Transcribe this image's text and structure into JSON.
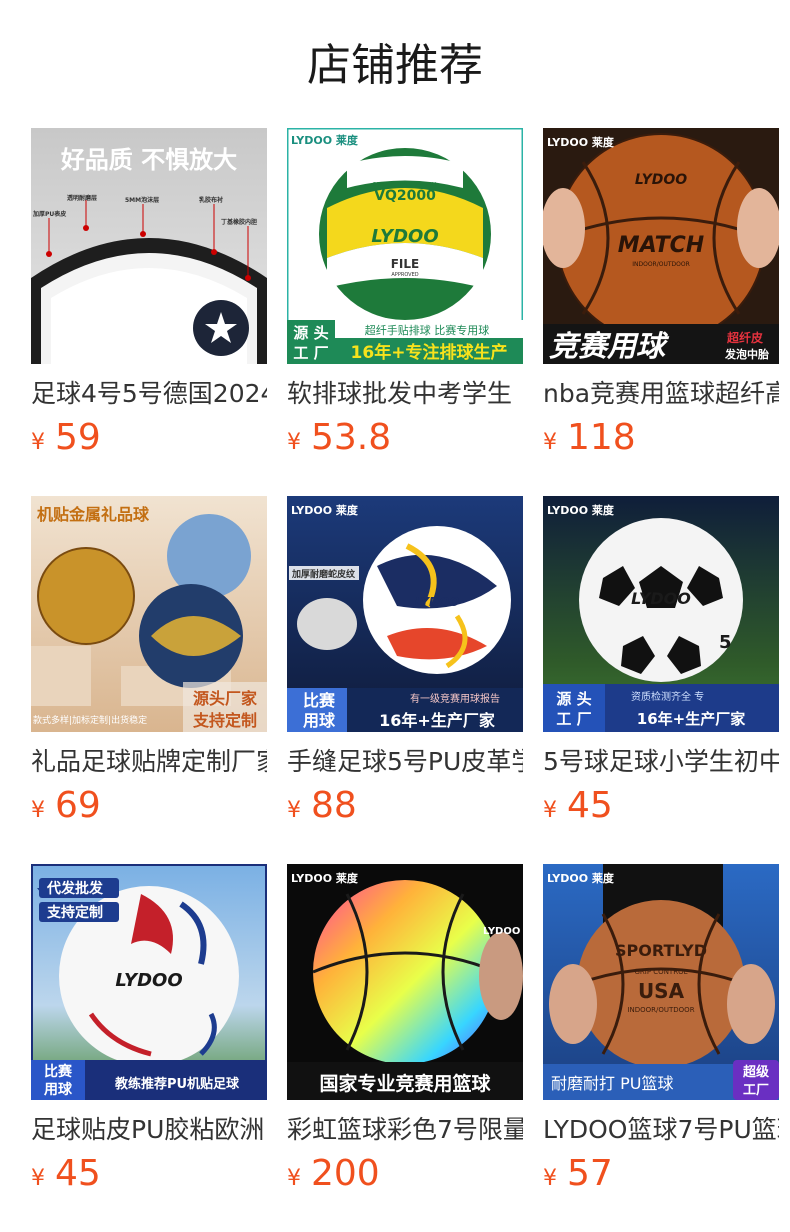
{
  "page": {
    "title": "店铺推荐"
  },
  "colors": {
    "price": "#f0501e",
    "title": "#1a1a1a",
    "text": "#333333"
  },
  "products": [
    {
      "name": "足球4号5号德国2024",
      "currency": "¥",
      "price": "59",
      "image_text": [
        "好品质 不惧放大",
        "透明耐磨层",
        "5MM泡沫层",
        "加厚PU表皮",
        "乳胶布衬",
        "丁基橡胶内胆"
      ]
    },
    {
      "name": "软排球批发中考学生",
      "currency": "¥",
      "price": "53.8",
      "image_text": [
        "LYDOO 莱度",
        "COMPETITION GAME BALL",
        "VQ2000",
        "LYDOO",
        "FILE",
        "APPROVED",
        "超纤手贴排球 比赛专用球",
        "源 头",
        "工 厂",
        "16年+专注排球生产"
      ]
    },
    {
      "name": "nba竞赛用篮球超纤高",
      "currency": "¥",
      "price": "118",
      "image_text": [
        "LYDOO 莱度",
        "LYDOO",
        "MATCH",
        "INDOOR/OUTDOOR",
        "竞赛用球",
        "超纤皮",
        "发泡中胎"
      ]
    },
    {
      "name": "礼品足球贴牌定制厂家",
      "currency": "¥",
      "price": "69",
      "image_text": [
        "机贴金属礼品球",
        "款式多样|加标定制|出货稳定",
        "源头厂家",
        "支持定制"
      ]
    },
    {
      "name": "手缝足球5号PU皮革学",
      "currency": "¥",
      "price": "88",
      "image_text": [
        "LYDOO 莱度",
        "加厚耐磨蛇皮纹",
        "LYDOO",
        "比赛",
        "用球",
        "有一级竞赛用球报告",
        "16年+生产厂家"
      ]
    },
    {
      "name": "5号球足球小学生初中",
      "currency": "¥",
      "price": "45",
      "image_text": [
        "LYDOO 莱度",
        "LYDOO",
        "5",
        "源 头",
        "工 厂",
        "资质检测齐全 专",
        "16年+生产厂家"
      ]
    },
    {
      "name": "足球贴皮PU胶粘欧洲",
      "currency": "¥",
      "price": "45",
      "image_text": [
        "代发批发",
        "支持定制",
        "LYDOO",
        "比赛",
        "用球",
        "教练推荐PU机贴足球"
      ]
    },
    {
      "name": "彩虹篮球彩色7号限量",
      "currency": "¥",
      "price": "200",
      "image_text": [
        "LYDOO 莱度",
        "LYDOO",
        "国家专业竞赛用篮球"
      ]
    },
    {
      "name": "LYDOO篮球7号PU篮球",
      "currency": "¥",
      "price": "57",
      "image_text": [
        "LYDOO 莱度",
        "SPORTLYD",
        "GRIP CONTROL",
        "USA",
        "INDOOR/OUTDOOR",
        "耐磨耐打 PU篮球",
        "超级",
        "工厂"
      ]
    }
  ]
}
